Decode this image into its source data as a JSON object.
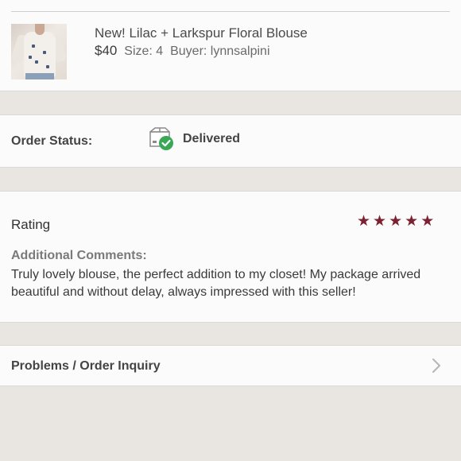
{
  "order_item": {
    "title": "New! Lilac + Larkspur Floral Blouse",
    "price": "$40",
    "size_label": "Size:",
    "size_value": "4",
    "buyer_label": "Buyer:",
    "buyer_value": "lynnsalpini",
    "thumbnail_icon": "product-photo-icon"
  },
  "order_status": {
    "label": "Order Status:",
    "value": "Delivered",
    "icon": "delivered-box-icon",
    "check_color": "#3aa757"
  },
  "rating": {
    "label": "Rating",
    "stars": 5,
    "max_stars": 5,
    "star_color": "#7b2130",
    "comments_label": "Additional Comments:",
    "comments_text": "Truly lovely blouse, the perfect addition to my closet! My package arrived beautiful and without delay, always impressed with this seller!"
  },
  "inquiry": {
    "label": "Problems / Order Inquiry",
    "icon": "chevron-right-icon"
  }
}
